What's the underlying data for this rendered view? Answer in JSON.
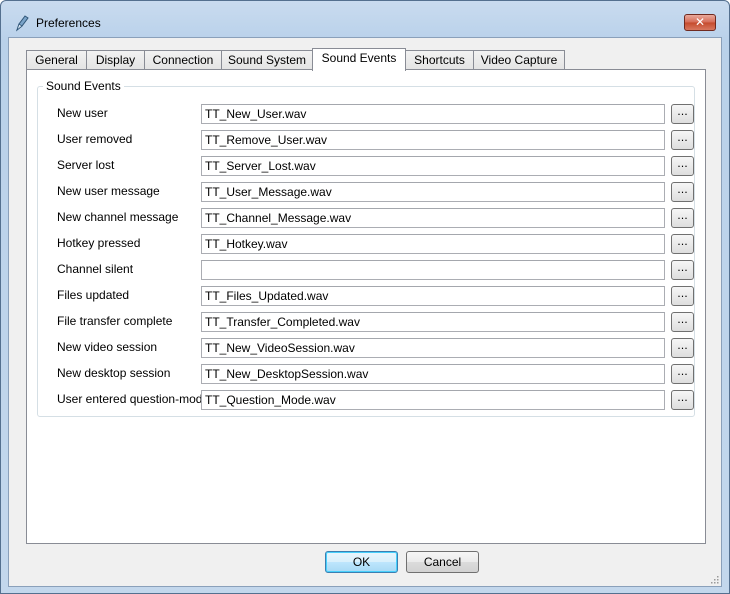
{
  "window": {
    "title": "Preferences",
    "close_glyph": "✕",
    "icons": {
      "app": "pen-icon",
      "close": "close-icon",
      "grip": "resize-grip-icon"
    }
  },
  "tabs": [
    {
      "label": "General"
    },
    {
      "label": "Display"
    },
    {
      "label": "Connection"
    },
    {
      "label": "Sound System"
    },
    {
      "label": "Sound Events",
      "active": true
    },
    {
      "label": "Shortcuts"
    },
    {
      "label": "Video Capture"
    }
  ],
  "group": {
    "title": "Sound Events"
  },
  "browse_label": "...",
  "events": [
    {
      "label": "New user",
      "file": "TT_New_User.wav"
    },
    {
      "label": "User removed",
      "file": "TT_Remove_User.wav"
    },
    {
      "label": "Server lost",
      "file": "TT_Server_Lost.wav"
    },
    {
      "label": "New user message",
      "file": "TT_User_Message.wav"
    },
    {
      "label": "New channel message",
      "file": "TT_Channel_Message.wav"
    },
    {
      "label": "Hotkey pressed",
      "file": "TT_Hotkey.wav"
    },
    {
      "label": "Channel silent",
      "file": ""
    },
    {
      "label": "Files updated",
      "file": "TT_Files_Updated.wav"
    },
    {
      "label": "File transfer complete",
      "file": "TT_Transfer_Completed.wav"
    },
    {
      "label": "New video session",
      "file": "TT_New_VideoSession.wav"
    },
    {
      "label": "New desktop session",
      "file": "TT_New_DesktopSession.wav"
    },
    {
      "label": "User entered question-mode",
      "file": "TT_Question_Mode.wav"
    }
  ],
  "buttons": {
    "ok": "OK",
    "cancel": "Cancel"
  },
  "colors": {
    "default_button_border": "#3c7fb1",
    "close_button": "#c54a2c"
  }
}
